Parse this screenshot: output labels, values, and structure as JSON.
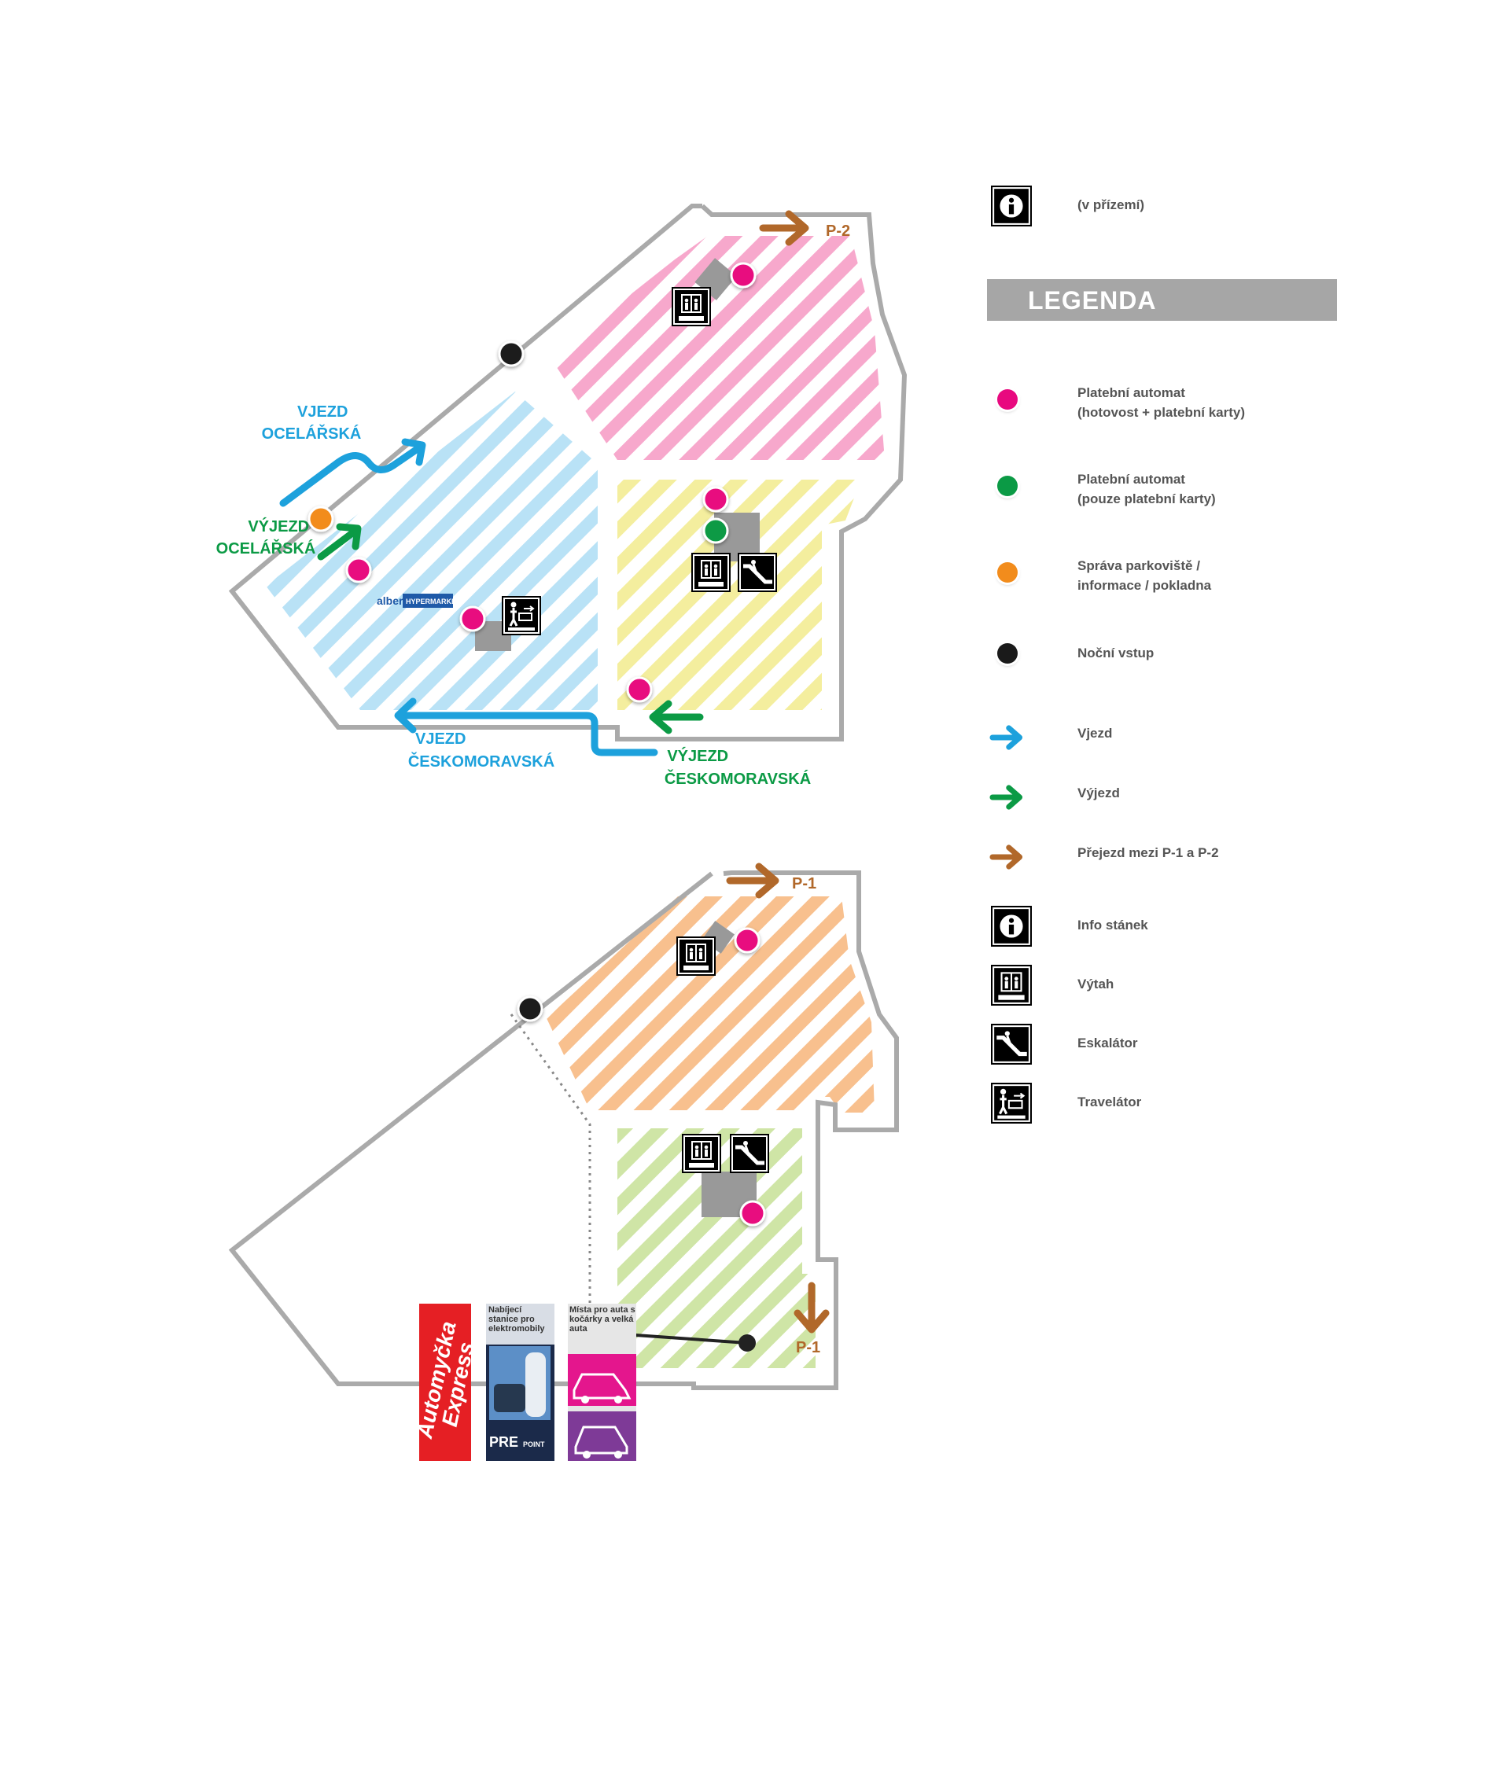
{
  "colors": {
    "payment_full": "#e8097f",
    "payment_card": "#0b9a45",
    "management": "#f28c1c",
    "night_entry": "#1a1a1a",
    "entry_arrow": "#1da1dc",
    "exit_arrow": "#0b9a45",
    "transfer_arrow": "#b1682a",
    "zone_pink": "#f7a8cc",
    "zone_blue": "#b9e2f6",
    "zone_yellow": "#f4ee9e",
    "zone_orange": "#f8c08e",
    "zone_green": "#cfe5a6",
    "outline": "#aaaaaa"
  },
  "map_top": {
    "transfer_label": "P-2",
    "entry_ocelarska": [
      "VJEZD",
      "OCELÁŘSKÁ"
    ],
    "exit_ocelarska": [
      "VÝJEZD",
      "OCELÁŘSKÁ"
    ],
    "entry_ceskomoravska": [
      "VJEZD",
      "ČESKOMORAVSKÁ"
    ],
    "exit_ceskomoravska": [
      "VÝJEZD",
      "ČESKOMORAVSKÁ"
    ],
    "store_logo": "albert",
    "store_logo_tag": "HYPERMARKET"
  },
  "map_bottom": {
    "transfer_label_top": "P-1",
    "transfer_label_bottom": "P-1",
    "ads": {
      "automoto_line1": "Automyčka",
      "automoto_line2": "Express",
      "charging_text": "Nabíjecí stanice pro elektromobily",
      "charging_brand_1": "PRE",
      "charging_brand_2": "POINT",
      "family_text": "Místa pro auta s kočárky a velká auta"
    }
  },
  "icon_caption": "VÝTAH",
  "legend": {
    "info_note": "(v přízemí)",
    "title": "LEGENDA",
    "items": [
      {
        "icon": "payment-full-dot",
        "label": "Platební automat\n(hotovost + platební karty)"
      },
      {
        "icon": "payment-card-dot",
        "label": "Platební automat\n(pouze platební karty)"
      },
      {
        "icon": "management-dot",
        "label": "Správa parkoviště /\ninformace / pokladna"
      },
      {
        "icon": "night-entry-dot",
        "label": "Noční vstup"
      },
      {
        "icon": "entry-arrow-icon",
        "label": "Vjezd"
      },
      {
        "icon": "exit-arrow-icon",
        "label": "Výjezd"
      },
      {
        "icon": "transfer-arrow-icon",
        "label": "Přejezd mezi P-1 a P-2"
      },
      {
        "icon": "info-icon",
        "label": "Info stánek"
      },
      {
        "icon": "elevator-icon",
        "label": "Výtah"
      },
      {
        "icon": "escalator-icon",
        "label": "Eskalátor"
      },
      {
        "icon": "travelator-icon",
        "label": "Travelátor"
      }
    ]
  }
}
